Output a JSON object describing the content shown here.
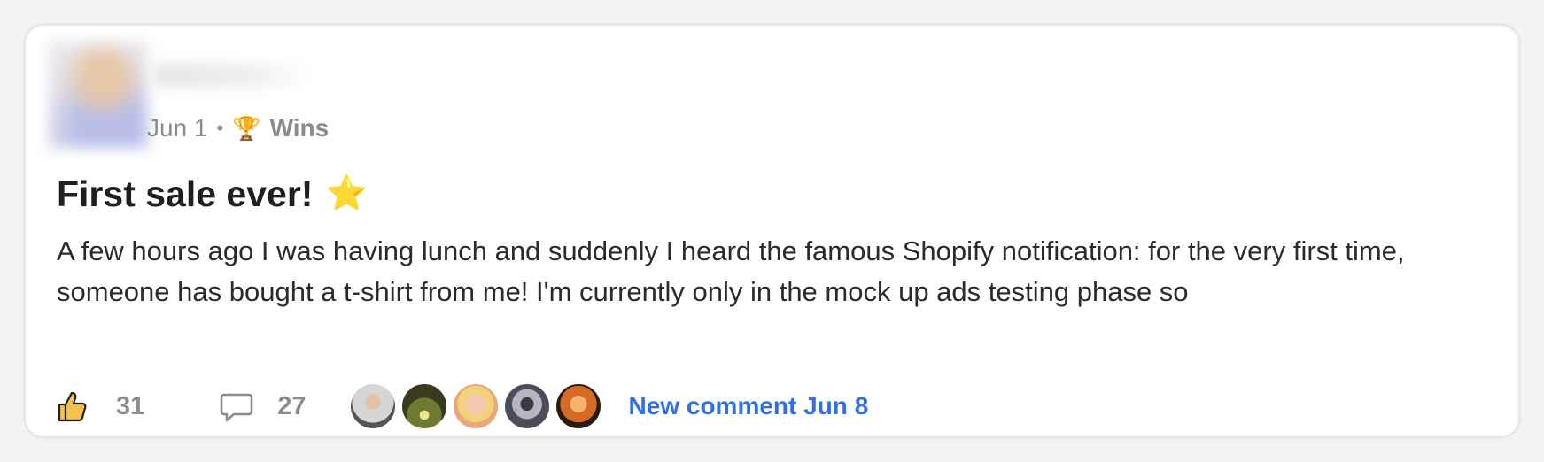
{
  "post": {
    "date": "Jun 1",
    "separator": "•",
    "category_icon": "trophy-icon",
    "category": "Wins",
    "title": "First sale ever!",
    "title_icon": "star-icon",
    "body": "A few hours ago I was having lunch and suddenly I heard the famous Shopify notification: for the very first time, someone has bought a t-shirt from me! I'm currently only in the mock up ads testing phase so"
  },
  "footer": {
    "likes": "31",
    "comments": "27",
    "new_comment_label": "New comment Jun 8"
  },
  "colors": {
    "accent_link": "#2f6fe8",
    "like_icon_fill": "#f6c24a",
    "muted_text": "#8c8c8c"
  }
}
